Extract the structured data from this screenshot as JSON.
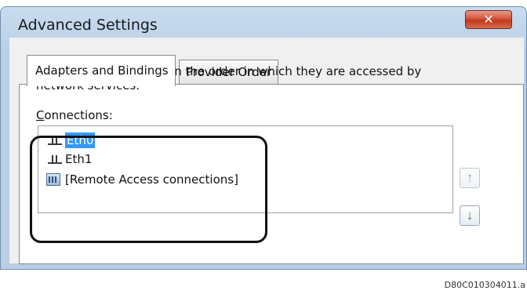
{
  "window": {
    "title": "Advanced Settings",
    "close_label": "✕"
  },
  "tabs": [
    {
      "label": "Adapters and Bindings",
      "active": true
    },
    {
      "label": "Provider Order",
      "active": false
    }
  ],
  "description": "Connections are listed in the order in which they are accessed by network services.",
  "connections": {
    "label_underlined": "C",
    "label_rest": "onnections:",
    "items": [
      {
        "label": "Eth0",
        "icon": "network-adapter-icon",
        "selected": true
      },
      {
        "label": "Eth1",
        "icon": "network-adapter-icon",
        "selected": false
      },
      {
        "label": "[Remote Access connections]",
        "icon": "remote-access-icon",
        "selected": false
      }
    ]
  },
  "buttons": {
    "move_up": "↑",
    "move_down": "↓"
  },
  "reference_code": "D80C010304011.a",
  "colors": {
    "selection": "#3399ff",
    "close_button": "#c0391c",
    "arrow": "#2e8b3a"
  }
}
